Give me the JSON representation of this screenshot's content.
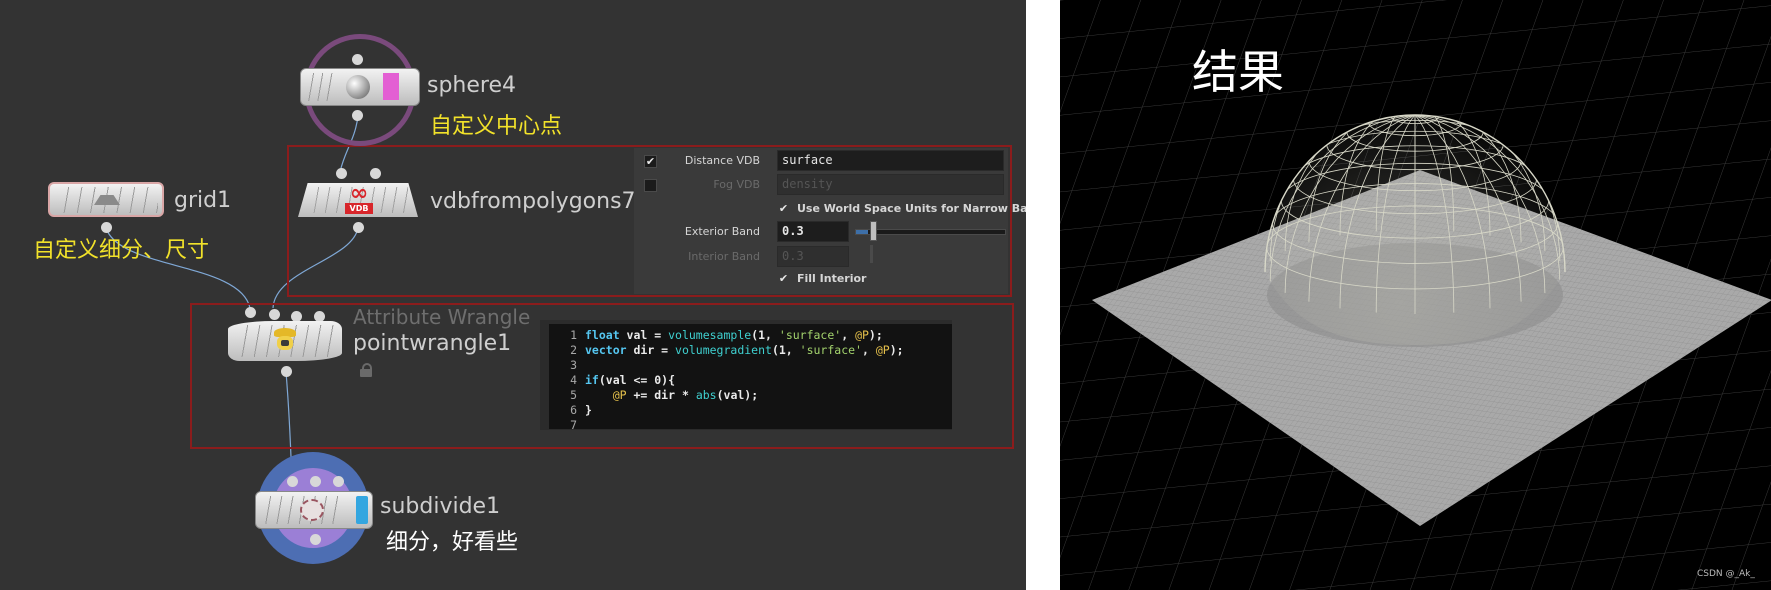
{
  "network": {
    "nodes": {
      "sphere": {
        "name": "sphere4",
        "note": "自定义中心点",
        "icon": "sphere-icon"
      },
      "vdb": {
        "name": "vdbfrompolygons7",
        "icon_text": "VDB",
        "icon": "vdb-infinity-icon"
      },
      "grid": {
        "name": "grid1",
        "note": "自定义细分、尺寸",
        "icon": "grid-plane-icon"
      },
      "wrangle": {
        "type_label": "Attribute Wrangle",
        "name": "pointwrangle1",
        "icon": "wrangle-cowboy-icon",
        "lock_icon": "lock-icon"
      },
      "subdivide": {
        "name": "subdivide1",
        "note": "细分，好看些",
        "icon": "subdivide-icon"
      }
    },
    "colors": {
      "sphere_ring": "#7a4a7c",
      "sphere_flag": "#e35fd3",
      "subdivide_ring_outer": "#4d6eb3",
      "subdivide_ring_inner": "#9b7fd6",
      "subdivide_flag": "#33a6e0",
      "wire": "#7fa8d6",
      "note": "#f2e22a",
      "highlight_box": "#8b1c1c"
    }
  },
  "vdb_params": {
    "distance_vdb": {
      "label": "Distance VDB",
      "checked": true,
      "value": "surface"
    },
    "fog_vdb": {
      "label": "Fog VDB",
      "checked": false,
      "placeholder": "density"
    },
    "world_space": {
      "label": "Use World Space Units for Narrow Band",
      "checked": true
    },
    "exterior_band": {
      "label": "Exterior Band",
      "value": "0.3",
      "slider_fraction": 0.08
    },
    "interior_band": {
      "label": "Interior Band",
      "value": "0.3",
      "enabled": false
    },
    "fill_interior": {
      "label": "Fill Interior",
      "checked": true
    }
  },
  "vex_code": {
    "line_numbers": [
      "1",
      "2",
      "3",
      "4",
      "5",
      "6",
      "7"
    ],
    "lines": [
      [
        [
          "kw",
          "float"
        ],
        [
          "plain",
          " val = "
        ],
        [
          "fn",
          "volumesample"
        ],
        [
          "plain",
          "(1, "
        ],
        [
          "str",
          "'surface'"
        ],
        [
          "plain",
          ", "
        ],
        [
          "attr",
          "@P"
        ],
        [
          "plain",
          ");"
        ]
      ],
      [
        [
          "kw",
          "vector"
        ],
        [
          "plain",
          " dir = "
        ],
        [
          "fn",
          "volumegradient"
        ],
        [
          "plain",
          "(1, "
        ],
        [
          "str",
          "'surface'"
        ],
        [
          "plain",
          ", "
        ],
        [
          "attr",
          "@P"
        ],
        [
          "plain",
          ");"
        ]
      ],
      [],
      [
        [
          "kw",
          "if"
        ],
        [
          "plain",
          "(val <= 0){"
        ]
      ],
      [
        [
          "plain",
          "    "
        ],
        [
          "attr",
          "@P"
        ],
        [
          "plain",
          " += dir * "
        ],
        [
          "fn",
          "abs"
        ],
        [
          "plain",
          "(val);"
        ]
      ],
      [
        [
          "plain",
          "}"
        ]
      ],
      []
    ]
  },
  "viewport": {
    "title": "结果",
    "watermark": "CSDN @_Ak_",
    "colors": {
      "mesh": "#d8d8c8",
      "plane": "#a9a9a9",
      "grid": "#555555",
      "background": "#000000"
    }
  }
}
